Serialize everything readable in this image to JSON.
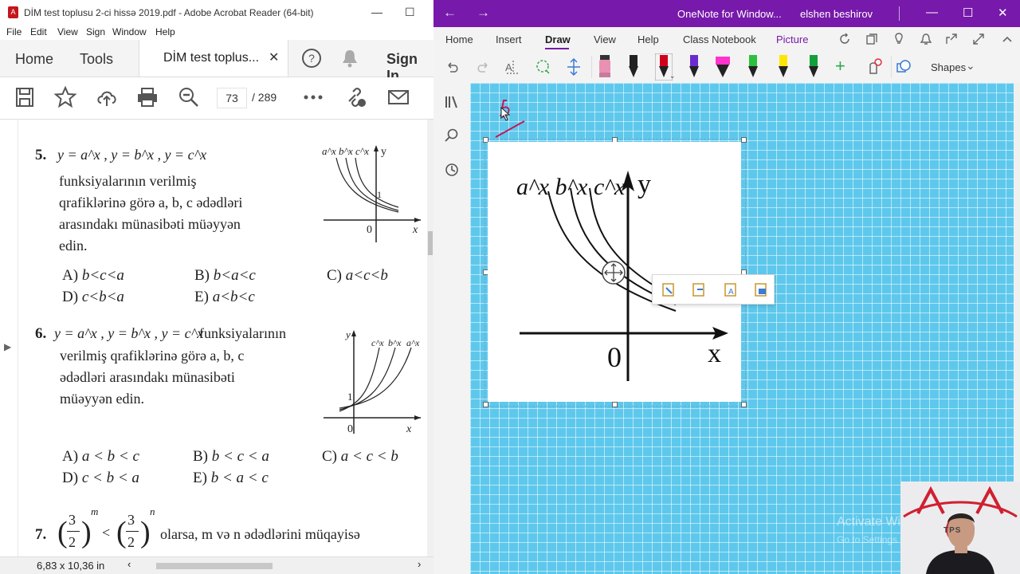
{
  "acrobat": {
    "title": "DİM test toplusu 2-ci hissə 2019.pdf - Adobe Acrobat Reader (64-bit)",
    "menu": [
      "File",
      "Edit",
      "View",
      "Sign",
      "Window",
      "Help"
    ],
    "tabs": {
      "home": "Home",
      "tools": "Tools",
      "document": "DİM test toplus...",
      "sign": "Sign In"
    },
    "page_current": "73",
    "page_total": "/ 289",
    "status_size": "6,83 x 10,36 in"
  },
  "document": {
    "q5": {
      "number": "5.",
      "formula": "y = a^x , y = b^x , y = c^x",
      "text": [
        "funksiyalarının verilmiş",
        "qrafiklərinə görə a, b, c ədədləri",
        "arasındakı münasibəti müəyyən",
        "edin."
      ],
      "graph_labels": {
        "curves": "a^x b^x c^x",
        "y": "y",
        "one": "1",
        "zero": "0",
        "x": "x"
      },
      "options": [
        {
          "letter": "A)",
          "text": "b<c<a"
        },
        {
          "letter": "B)",
          "text": "b<a<c"
        },
        {
          "letter": "C)",
          "text": "a<c<b"
        },
        {
          "letter": "D)",
          "text": "c<b<a"
        },
        {
          "letter": "E)",
          "text": "a<b<c"
        }
      ]
    },
    "q6": {
      "number": "6.",
      "formula": "y = a^x , y = b^x , y = c^x",
      "text": [
        "funksiyalarının",
        "verilmiş qrafiklərinə görə a, b, c",
        "ədədləri arasındakı münasibəti",
        "müəyyən edin."
      ],
      "graph_labels": {
        "y": "y",
        "c": "c^x",
        "b": "b^x",
        "a": "a^x",
        "one": "1",
        "zero": "0",
        "x": "x"
      },
      "options": [
        {
          "letter": "A)",
          "text": "a < b < c"
        },
        {
          "letter": "B)",
          "text": "b < c < a"
        },
        {
          "letter": "C)",
          "text": "a < c < b"
        },
        {
          "letter": "D)",
          "text": "c < b < a"
        },
        {
          "letter": "E)",
          "text": "b < a < c"
        }
      ]
    },
    "q7": {
      "number": "7.",
      "frac_num": "3",
      "frac_den": "2",
      "exp_left": "m",
      "exp_right": "n",
      "lt": "<",
      "text": "olarsa, m və n ədədlərini müqayisə"
    }
  },
  "onenote": {
    "title": "OneNote for Window...",
    "user": "elshen beshirov",
    "tabs": [
      "Home",
      "Insert",
      "Draw",
      "View",
      "Help",
      "Class Notebook",
      "Picture"
    ],
    "active_tab": "Draw",
    "shapes_label": "Shapes",
    "pasted_graph": {
      "curves": "a^x b^x c^x",
      "y": "y",
      "zero": "0",
      "x": "x"
    },
    "watermark": [
      "Activate Windows",
      "Go to Settings to activate Windows."
    ],
    "colors": {
      "title_bar": "#7719aa",
      "canvas": "#5ec8ec",
      "ink": "#c2185b"
    }
  },
  "webcam": {
    "sign_text": "TPS"
  }
}
